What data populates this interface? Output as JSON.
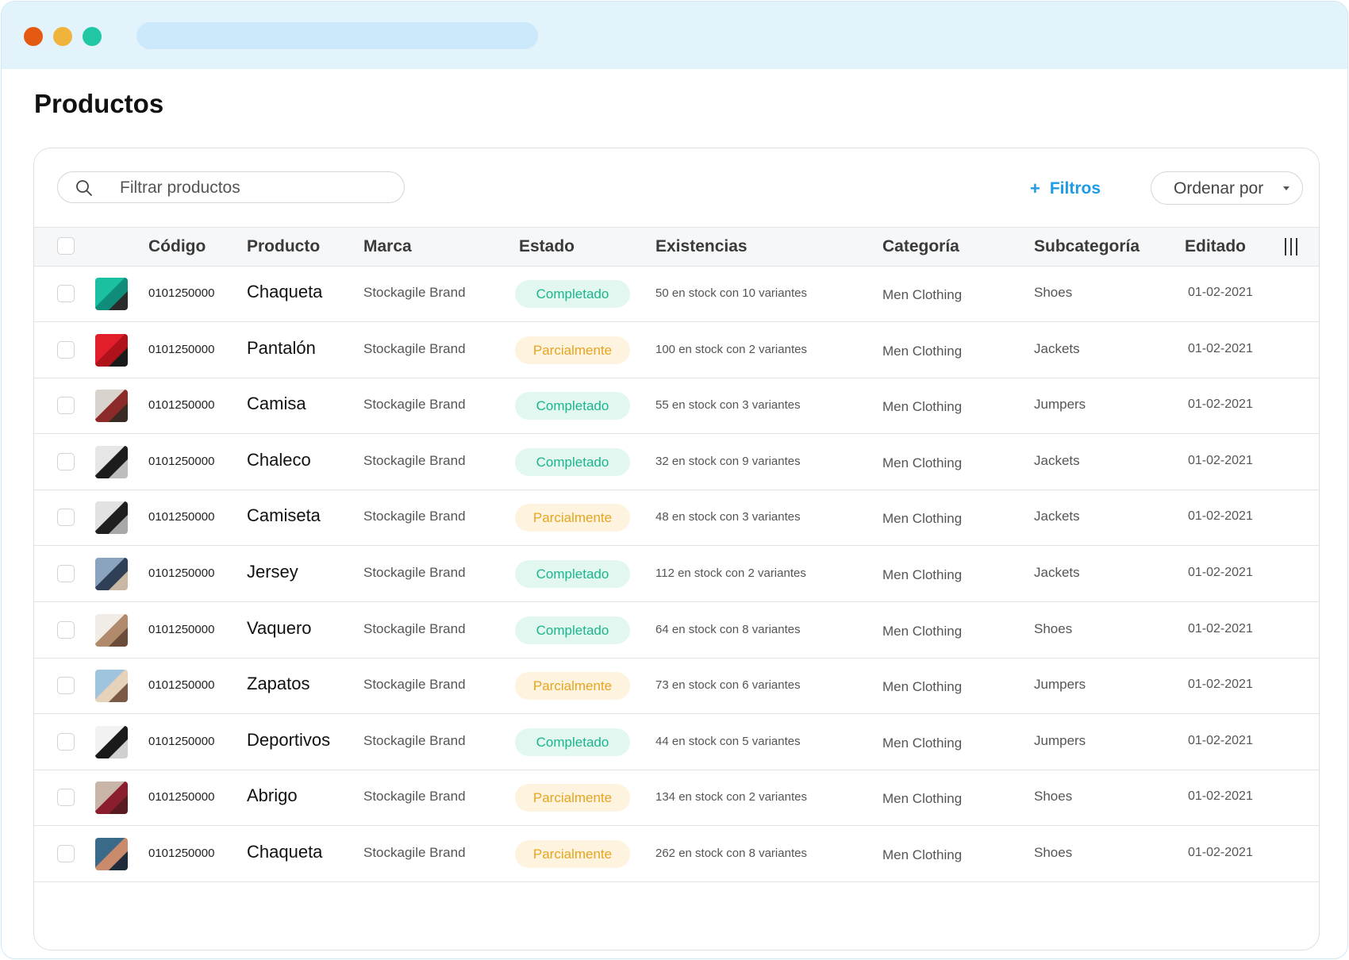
{
  "page": {
    "title": "Productos"
  },
  "toolbar": {
    "search_placeholder": "Filtrar productos",
    "filters_label": "Filtros",
    "plus_symbol": "+",
    "sort_label": "Ordenar por"
  },
  "table": {
    "columns": [
      "Código",
      "Producto",
      "Marca",
      "Estado",
      "Existencias",
      "Categoría",
      "Subcategoría",
      "Editado"
    ],
    "rows": [
      {
        "code": "0101250000",
        "product": "Chaqueta",
        "brand": "Stockagile Brand",
        "status": "Completado",
        "status_type": "done",
        "stock": "50 en stock con 10 variantes",
        "category": "Men Clothing",
        "subcategory": "Shoes",
        "edited": "01-02-2021",
        "thumb_colors": [
          "#1bbfa2",
          "#0f8c7a",
          "#2b2b2b"
        ]
      },
      {
        "code": "0101250000",
        "product": "Pantalón",
        "brand": "Stockagile Brand",
        "status": "Parcialmente",
        "status_type": "partial",
        "stock": "100 en stock con 2 variantes",
        "category": "Men Clothing",
        "subcategory": "Jackets",
        "edited": "01-02-2021",
        "thumb_colors": [
          "#e21e2a",
          "#b0121b",
          "#1a1a1a"
        ]
      },
      {
        "code": "0101250000",
        "product": "Camisa",
        "brand": "Stockagile Brand",
        "status": "Completado",
        "status_type": "done",
        "stock": "55 en stock con 3 variantes",
        "category": "Men Clothing",
        "subcategory": "Jumpers",
        "edited": "01-02-2021",
        "thumb_colors": [
          "#d8d3cc",
          "#8c2a2a",
          "#3a2a24"
        ]
      },
      {
        "code": "0101250000",
        "product": "Chaleco",
        "brand": "Stockagile Brand",
        "status": "Completado",
        "status_type": "done",
        "stock": "32 en  stock con 9 variantes",
        "category": "Men Clothing",
        "subcategory": "Jackets",
        "edited": "01-02-2021",
        "thumb_colors": [
          "#e6e6e6",
          "#1c1c1c",
          "#bdbdbd"
        ]
      },
      {
        "code": "0101250000",
        "product": "Camiseta",
        "brand": "Stockagile Brand",
        "status": "Parcialmente",
        "status_type": "partial",
        "stock": "48 en stock con 3 variantes",
        "category": "Men Clothing",
        "subcategory": "Jackets",
        "edited": "01-02-2021",
        "thumb_colors": [
          "#e2e2e2",
          "#1f1f1f",
          "#a8a8a8"
        ]
      },
      {
        "code": "0101250000",
        "product": "Jersey",
        "brand": "Stockagile Brand",
        "status": "Completado",
        "status_type": "done",
        "stock": "112 en stock con 2 variantes",
        "category": "Men Clothing",
        "subcategory": "Jackets",
        "edited": "01-02-2021",
        "thumb_colors": [
          "#8aa4bf",
          "#2f3f55",
          "#c9b9a4"
        ]
      },
      {
        "code": "0101250000",
        "product": "Vaquero",
        "brand": "Stockagile Brand",
        "status": "Completado",
        "status_type": "done",
        "stock": "64 en stock con 8 variantes",
        "category": "Men Clothing",
        "subcategory": "Shoes",
        "edited": "01-02-2021",
        "thumb_colors": [
          "#f1ece6",
          "#b08a6a",
          "#6b4b3a"
        ]
      },
      {
        "code": "0101250000",
        "product": "Zapatos",
        "brand": "Stockagile Brand",
        "status": "Parcialmente",
        "status_type": "partial",
        "stock": "73 en stock con 6 variantes",
        "category": "Men Clothing",
        "subcategory": "Jumpers",
        "edited": "01-02-2021",
        "thumb_colors": [
          "#9fc4dd",
          "#e6d2bb",
          "#7a5a44"
        ]
      },
      {
        "code": "0101250000",
        "product": "Deportivos",
        "brand": "Stockagile Brand",
        "status": "Completado",
        "status_type": "done",
        "stock": "44 en stock con 5 variantes",
        "category": "Men Clothing",
        "subcategory": "Jumpers",
        "edited": "01-02-2021",
        "thumb_colors": [
          "#f2f2f2",
          "#1a1a1a",
          "#d0d0d0"
        ]
      },
      {
        "code": "0101250000",
        "product": "Abrigo",
        "brand": "Stockagile Brand",
        "status": "Parcialmente",
        "status_type": "partial",
        "stock": "134 en stock con 2 variantes",
        "category": "Men Clothing",
        "subcategory": "Shoes",
        "edited": "01-02-2021",
        "thumb_colors": [
          "#c9b5a8",
          "#8b1e2e",
          "#5a1a22"
        ]
      },
      {
        "code": "0101250000",
        "product": "Chaqueta",
        "brand": "Stockagile Brand",
        "status": "Parcialmente",
        "status_type": "partial",
        "stock": "262 en stock con 8 variantes",
        "category": "Men Clothing",
        "subcategory": "Shoes",
        "edited": "01-02-2021",
        "thumb_colors": [
          "#3a6a8a",
          "#c98b6b",
          "#1f2a3a"
        ]
      }
    ]
  },
  "colors": {
    "accent": "#1e9ae6",
    "done_text": "#1bb58c",
    "partial_text": "#e6a520"
  }
}
